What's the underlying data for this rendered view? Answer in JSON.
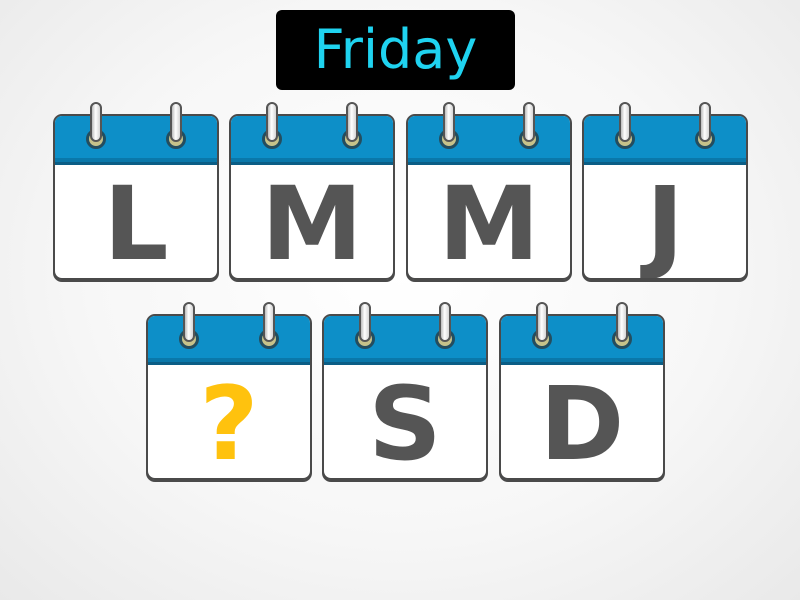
{
  "title": "Friday",
  "row1": [
    "L",
    "M",
    "M",
    "J"
  ],
  "row2": [
    "?",
    "S",
    "D"
  ],
  "colors": {
    "title_text": "#1fd3f0",
    "title_bg": "#000000",
    "calendar_header": "#0d8fc8",
    "letter": "#555555",
    "question_mark": "#ffc20e"
  }
}
